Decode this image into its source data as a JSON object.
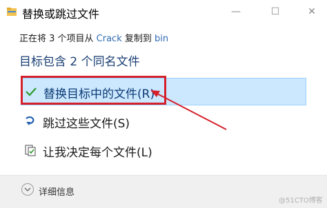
{
  "window": {
    "title": "替换或跳过文件",
    "controls": {
      "minimize": "—",
      "maximize": "☐",
      "close": "✕"
    }
  },
  "status": {
    "prefix": "正在将 3 个项目从 ",
    "source": "Crack",
    "middle": " 复制到 ",
    "destination": "bin"
  },
  "heading": "目标包含 2 个同名文件",
  "options": [
    {
      "label": "替换目标中的文件(R)",
      "icon": "checkmark-icon",
      "selected": true
    },
    {
      "label": "跳过这些文件(S)",
      "icon": "skip-icon",
      "selected": false
    },
    {
      "label": "让我决定每个文件(L)",
      "icon": "decide-icon",
      "selected": false
    }
  ],
  "footer": {
    "details_label": "详细信息",
    "icon": "chevron-down-icon"
  },
  "watermark": "@51CTO博客",
  "colors": {
    "selection_fill": "#cce8ff",
    "selection_border": "#99d1ff",
    "highlight_red": "#d51f2a",
    "checkmark_green": "#2e9b2e",
    "link_blue": "#2f6bb2"
  }
}
